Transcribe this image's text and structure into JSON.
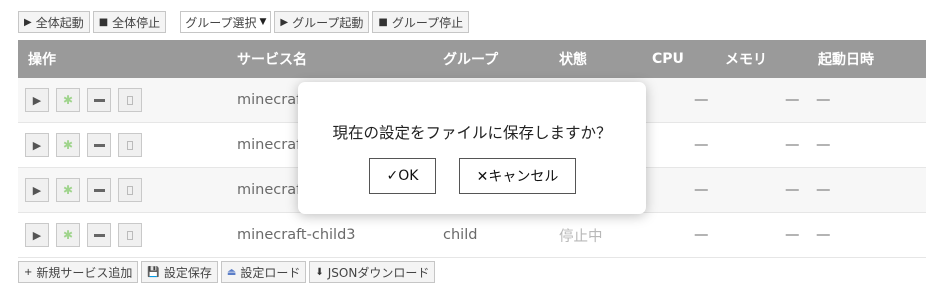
{
  "toolbar": {
    "start_all": {
      "icon": "▶",
      "label": "全体起動"
    },
    "stop_all": {
      "icon": "■",
      "label": "全体停止"
    },
    "group_select": {
      "value": "グループ選択"
    },
    "group_start": {
      "icon": "▶",
      "label": "グループ起動"
    },
    "group_stop": {
      "icon": "■",
      "label": "グループ停止"
    }
  },
  "table": {
    "headers": {
      "actions": "操作",
      "service_name": "サービス名",
      "group": "グループ",
      "status": "状態",
      "cpu": "CPU",
      "memory": "メモリ",
      "started_at": "起動日時"
    },
    "rows": [
      {
        "name": "minecraf",
        "group": "",
        "status": "",
        "cpu": "—",
        "memory": "—",
        "started": "—"
      },
      {
        "name": "minecraf",
        "group": "",
        "status": "",
        "cpu": "—",
        "memory": "—",
        "started": "—"
      },
      {
        "name": "minecraf",
        "group": "",
        "status": "",
        "cpu": "—",
        "memory": "—",
        "started": "—"
      },
      {
        "name": "minecraft-child3",
        "group": "child",
        "status": "停止中",
        "cpu": "—",
        "memory": "—",
        "started": "—"
      }
    ]
  },
  "bottom_toolbar": {
    "add_service": {
      "icon": "+",
      "label": "新規サービス追加"
    },
    "save_settings": {
      "icon": "💾",
      "label": "設定保存"
    },
    "load_settings": {
      "icon": "⏏",
      "label": "設定ロード"
    },
    "json_download": {
      "icon": "⬇",
      "label": "JSONダウンロード"
    }
  },
  "dialog": {
    "message": "現在の設定をファイルに保存しますか？",
    "ok_label": "✓OK",
    "cancel_label": "✕キャンセル"
  },
  "colors": {
    "header_bg": "#9a9a9a",
    "row_stripe": "#f7f7f7",
    "button_bg": "#f4f4f4"
  }
}
